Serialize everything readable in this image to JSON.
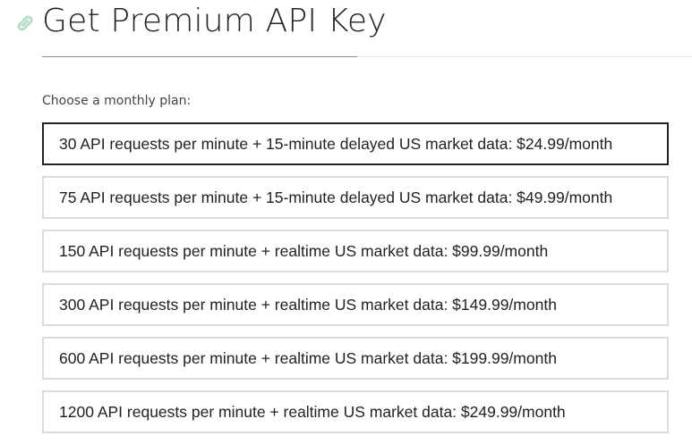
{
  "header": {
    "title": "Get Premium API Key",
    "icon": "link-icon",
    "icon_color": "#b7dcc6"
  },
  "form": {
    "plan_label": "Choose a monthly plan:",
    "selected_index": 0,
    "plans": [
      {
        "label": "30 API requests per minute + 15-minute delayed US market data: $24.99/month"
      },
      {
        "label": "75 API requests per minute + 15-minute delayed US market data: $49.99/month"
      },
      {
        "label": "150 API requests per minute + realtime US market data: $99.99/month"
      },
      {
        "label": "300 API requests per minute + realtime US market data: $149.99/month"
      },
      {
        "label": "600 API requests per minute + realtime US market data: $199.99/month"
      },
      {
        "label": "1200 API requests per minute + realtime US market data: $249.99/month"
      }
    ]
  }
}
